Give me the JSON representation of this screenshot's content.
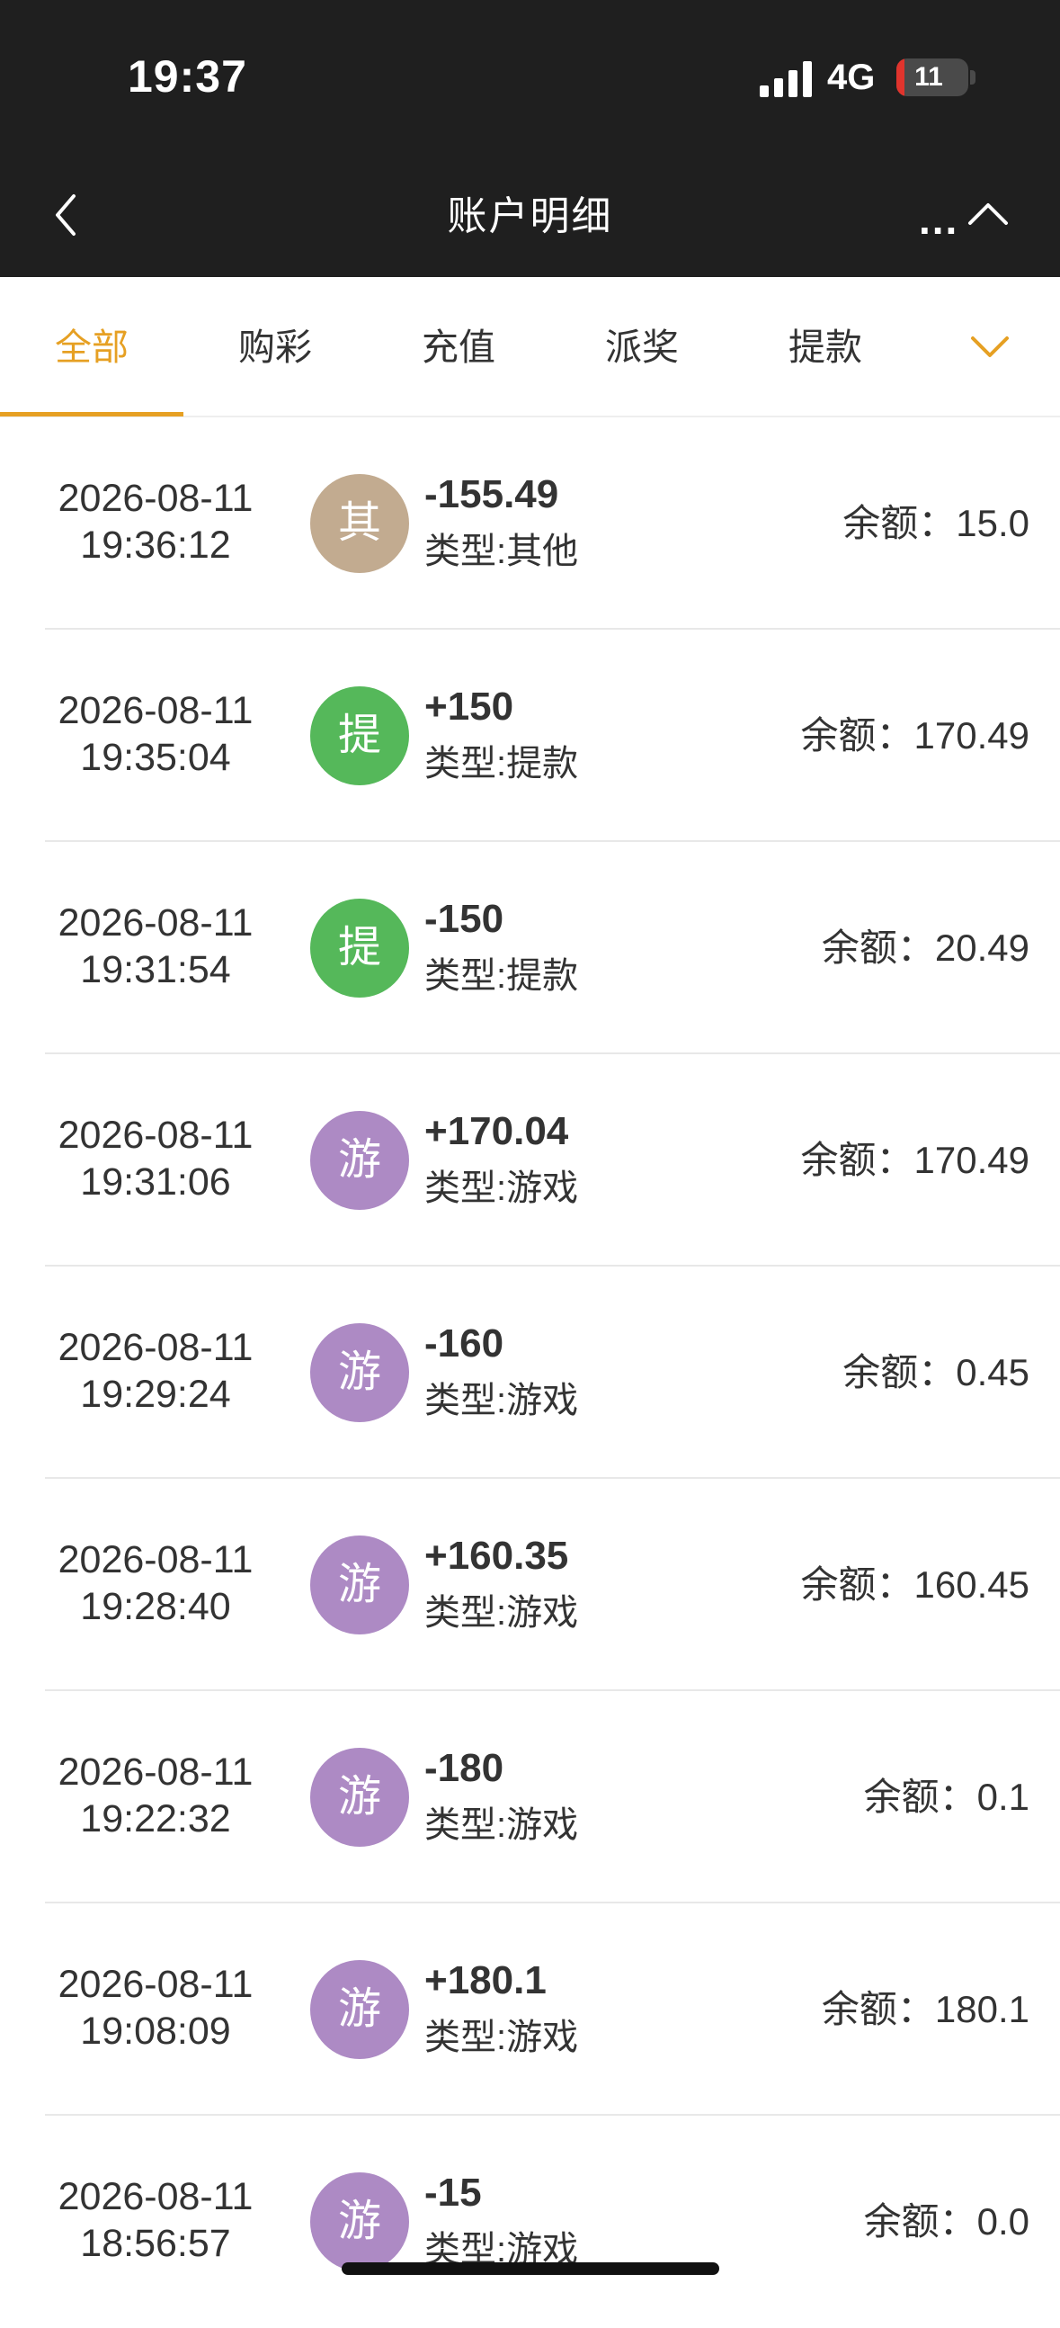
{
  "status_bar": {
    "time": "19:37",
    "network": "4G",
    "battery": "11",
    "battery_level": 0.11
  },
  "header": {
    "title": "账户明细",
    "back_icon": "chevron-left-icon",
    "more_label": "...",
    "collapse_icon": "chevron-up-icon"
  },
  "tabs": {
    "items": [
      {
        "label": "全部",
        "active": true
      },
      {
        "label": "购彩",
        "active": false
      },
      {
        "label": "充值",
        "active": false
      },
      {
        "label": "派奖",
        "active": false
      },
      {
        "label": "提款",
        "active": false
      }
    ],
    "dropdown_icon": "chevron-down-icon"
  },
  "colors": {
    "accent": "#e6a023",
    "header_bg": "#1f1f1f",
    "badge_other": "#c2ab90",
    "badge_withdraw": "#55b85a",
    "badge_game": "#ad8ac4"
  },
  "transactions": [
    {
      "date": "2026-08-11",
      "time": "19:36:12",
      "badge": "其",
      "badge_kind": "other",
      "amount": "-155.49",
      "type": "类型:其他",
      "balance": "余额：15.0"
    },
    {
      "date": "2026-08-11",
      "time": "19:35:04",
      "badge": "提",
      "badge_kind": "withdraw",
      "amount": "+150",
      "type": "类型:提款",
      "balance": "余额：170.49"
    },
    {
      "date": "2026-08-11",
      "time": "19:31:54",
      "badge": "提",
      "badge_kind": "withdraw",
      "amount": "-150",
      "type": "类型:提款",
      "balance": "余额：20.49"
    },
    {
      "date": "2026-08-11",
      "time": "19:31:06",
      "badge": "游",
      "badge_kind": "game",
      "amount": "+170.04",
      "type": "类型:游戏",
      "balance": "余额：170.49"
    },
    {
      "date": "2026-08-11",
      "time": "19:29:24",
      "badge": "游",
      "badge_kind": "game",
      "amount": "-160",
      "type": "类型:游戏",
      "balance": "余额：0.45"
    },
    {
      "date": "2026-08-11",
      "time": "19:28:40",
      "badge": "游",
      "badge_kind": "game",
      "amount": "+160.35",
      "type": "类型:游戏",
      "balance": "余额：160.45"
    },
    {
      "date": "2026-08-11",
      "time": "19:22:32",
      "badge": "游",
      "badge_kind": "game",
      "amount": "-180",
      "type": "类型:游戏",
      "balance": "余额：0.1"
    },
    {
      "date": "2026-08-11",
      "time": "19:08:09",
      "badge": "游",
      "badge_kind": "game",
      "amount": "+180.1",
      "type": "类型:游戏",
      "balance": "余额：180.1"
    },
    {
      "date": "2026-08-11",
      "time": "18:56:57",
      "badge": "游",
      "badge_kind": "game",
      "amount": "-15",
      "type": "类型:游戏",
      "balance": "余额：0.0"
    }
  ]
}
